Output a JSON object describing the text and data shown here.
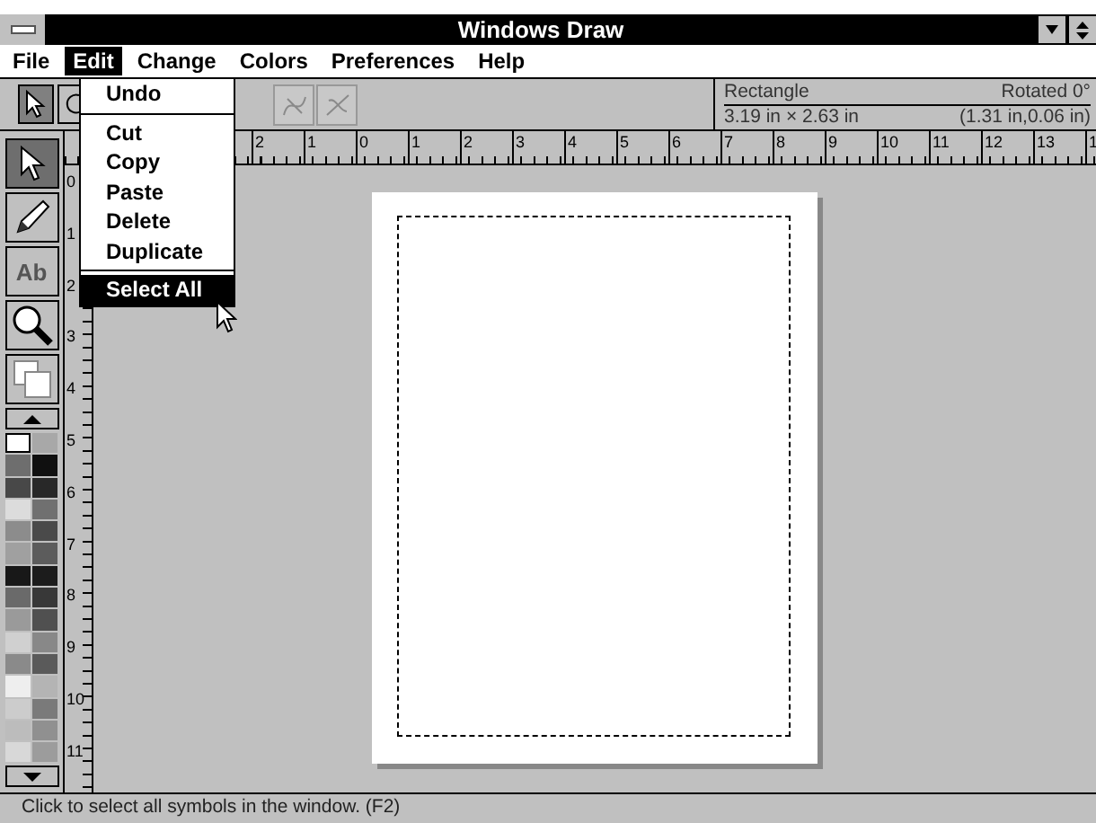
{
  "window": {
    "title": "Windows Draw"
  },
  "menu": [
    {
      "label": "File",
      "selected": false
    },
    {
      "label": "Edit",
      "selected": true
    },
    {
      "label": "Change",
      "selected": false
    },
    {
      "label": "Colors",
      "selected": false
    },
    {
      "label": "Preferences",
      "selected": false
    },
    {
      "label": "Help",
      "selected": false
    }
  ],
  "edit_menu": [
    {
      "kind": "item",
      "label": "Undo",
      "selected": false
    },
    {
      "kind": "separator"
    },
    {
      "kind": "item",
      "label": "Cut",
      "selected": false
    },
    {
      "kind": "item",
      "label": "Copy",
      "selected": false
    },
    {
      "kind": "item",
      "label": "Paste",
      "selected": false
    },
    {
      "kind": "item",
      "label": "Delete",
      "selected": false
    },
    {
      "kind": "item",
      "label": "Duplicate",
      "selected": false
    },
    {
      "kind": "separator"
    },
    {
      "kind": "item",
      "label": "Select All",
      "selected": true
    }
  ],
  "toolbar": {
    "modes": [
      {
        "kind": "arrow",
        "selected": true
      },
      {
        "kind": "rotate",
        "selected": false
      }
    ],
    "info": {
      "shape": "Rectangle",
      "rotation": "Rotated 0°",
      "size": "3.19 in × 2.63 in",
      "position": "(1.31 in,0.06 in)"
    }
  },
  "top_ruler": [
    "2",
    "1",
    "0",
    "1",
    "2",
    "3",
    "4",
    "5",
    "6",
    "7",
    "8",
    "9",
    "10",
    "11",
    "12",
    "13",
    "1"
  ],
  "left_ruler": [
    "0",
    "1",
    "2",
    "3",
    "4",
    "5",
    "6",
    "7",
    "8",
    "9",
    "10",
    "11"
  ],
  "tools": [
    {
      "kind": "arrow",
      "selected": true
    },
    {
      "kind": "pencil",
      "selected": false
    },
    {
      "kind": "text",
      "glyph": "Ab",
      "selected": false
    },
    {
      "kind": "zoom",
      "selected": false
    },
    {
      "kind": "shapes",
      "selected": false
    }
  ],
  "palette": [
    {
      "color": "#ffffff",
      "selected": true
    },
    {
      "color": "#a8a8a8",
      "selected": false
    },
    {
      "color": "#6e6e6e",
      "selected": false
    },
    {
      "color": "#101010",
      "selected": false
    },
    {
      "color": "#484848",
      "selected": false
    },
    {
      "color": "#282828",
      "selected": false
    },
    {
      "color": "#dcdcdc",
      "selected": false
    },
    {
      "color": "#707070",
      "selected": false
    },
    {
      "color": "#8c8c8c",
      "selected": false
    },
    {
      "color": "#4a4a4a",
      "selected": false
    },
    {
      "color": "#a0a0a0",
      "selected": false
    },
    {
      "color": "#5c5c5c",
      "selected": false
    },
    {
      "color": "#181818",
      "selected": false
    },
    {
      "color": "#1c1c1c",
      "selected": false
    },
    {
      "color": "#6a6a6a",
      "selected": false
    },
    {
      "color": "#383838",
      "selected": false
    },
    {
      "color": "#9a9a9a",
      "selected": false
    },
    {
      "color": "#505050",
      "selected": false
    },
    {
      "color": "#d0d0d0",
      "selected": false
    },
    {
      "color": "#888888",
      "selected": false
    },
    {
      "color": "#8a8a8a",
      "selected": false
    },
    {
      "color": "#5a5a5a",
      "selected": false
    },
    {
      "color": "#eeeeee",
      "selected": false
    },
    {
      "color": "#b4b4b4",
      "selected": false
    },
    {
      "color": "#cccccc",
      "selected": false
    },
    {
      "color": "#7a7a7a",
      "selected": false
    },
    {
      "color": "#bcbcbc",
      "selected": false
    },
    {
      "color": "#909090",
      "selected": false
    },
    {
      "color": "#d8d8d8",
      "selected": false
    },
    {
      "color": "#9c9c9c",
      "selected": false
    }
  ],
  "status_bar": "Click to select all symbols in the window. (F2)"
}
